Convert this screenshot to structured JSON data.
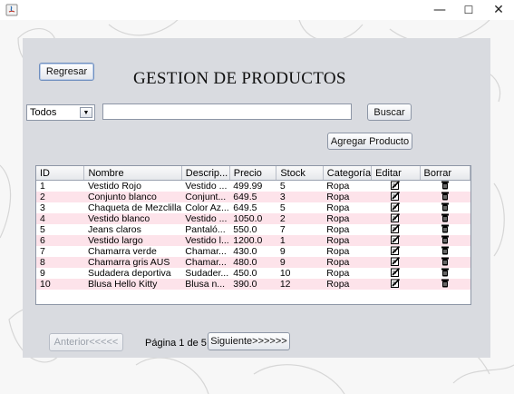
{
  "window": {
    "minimize": "—",
    "maximize": "☐",
    "close": "✕"
  },
  "header": {
    "back_label": "Regresar",
    "title": "GESTION DE PRODUCTOS"
  },
  "filters": {
    "category_selected": "Todos",
    "search_value": "",
    "search_button": "Buscar",
    "add_button": "Agregar Producto"
  },
  "table": {
    "columns": [
      "ID",
      "Nombre",
      "Descrip...",
      "Precio",
      "Stock",
      "Categoría",
      "Editar",
      "Borrar"
    ],
    "rows": [
      [
        "1",
        "Vestido Rojo",
        "Vestido ...",
        "499.99",
        "5",
        "Ropa"
      ],
      [
        "2",
        "Conjunto blanco",
        "Conjunt...",
        "649.5",
        "3",
        "Ropa"
      ],
      [
        "3",
        "Chaqueta de Mezclilla",
        "Color Az...",
        "649.5",
        "5",
        "Ropa"
      ],
      [
        "4",
        "Vestido blanco",
        "Vestido ...",
        "1050.0",
        "2",
        "Ropa"
      ],
      [
        "5",
        "Jeans claros",
        "Pantaló...",
        "550.0",
        "7",
        "Ropa"
      ],
      [
        "6",
        "Vestido largo",
        "Vestido l...",
        "1200.0",
        "1",
        "Ropa"
      ],
      [
        "7",
        "Chamarra verde",
        "Chamar...",
        "430.0",
        "9",
        "Ropa"
      ],
      [
        "8",
        "Chamarra gris AUS",
        "Chamar...",
        "480.0",
        "9",
        "Ropa"
      ],
      [
        "9",
        "Sudadera deportiva",
        "Sudader...",
        "450.0",
        "10",
        "Ropa"
      ],
      [
        "10",
        "Blusa Hello Kitty",
        "Blusa n...",
        "390.0",
        "12",
        "Ropa"
      ]
    ],
    "edit_icon": "edit-icon",
    "delete_icon": "trash-icon"
  },
  "pagination": {
    "prev_label": "Anterior<<<<<",
    "page_label": "Página 1 de 5",
    "next_label": "Siguiente>>>>>>"
  },
  "colors": {
    "panel": "#d9dbe0",
    "row_alt": "#fde3ea",
    "background": "#f7f7f7"
  }
}
